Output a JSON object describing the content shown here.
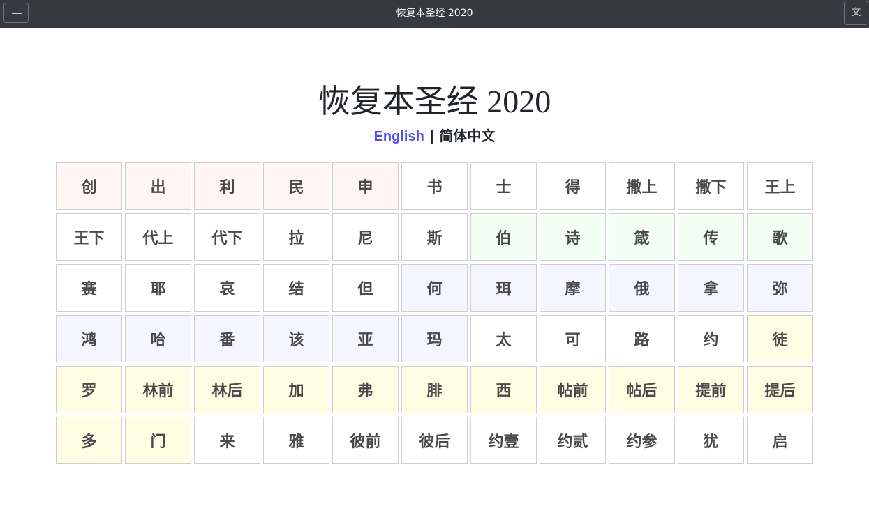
{
  "header": {
    "title": "恢复本圣经 2020",
    "menu_icon": "hamburger-menu-icon",
    "lang_button_label": "文"
  },
  "main": {
    "title": "恢复本圣经 2020",
    "languages": {
      "english": "English",
      "separator": "|",
      "chinese": "简体中文"
    }
  },
  "colors": {
    "law": "#fff5f5",
    "history": "#ffffff",
    "poetry": "#f3fff3",
    "prophets": "#f4f5ff",
    "new_testament": "#fefee4",
    "english_link": "#5050e6",
    "topbar": "#343a40"
  },
  "books": [
    {
      "name": "创",
      "group": "law"
    },
    {
      "name": "出",
      "group": "law"
    },
    {
      "name": "利",
      "group": "law"
    },
    {
      "name": "民",
      "group": "law"
    },
    {
      "name": "申",
      "group": "law"
    },
    {
      "name": "书",
      "group": "history"
    },
    {
      "name": "士",
      "group": "history"
    },
    {
      "name": "得",
      "group": "history"
    },
    {
      "name": "撒上",
      "group": "history"
    },
    {
      "name": "撒下",
      "group": "history"
    },
    {
      "name": "王上",
      "group": "history"
    },
    {
      "name": "王下",
      "group": "history"
    },
    {
      "name": "代上",
      "group": "history"
    },
    {
      "name": "代下",
      "group": "history"
    },
    {
      "name": "拉",
      "group": "history"
    },
    {
      "name": "尼",
      "group": "history"
    },
    {
      "name": "斯",
      "group": "history"
    },
    {
      "name": "伯",
      "group": "poetry"
    },
    {
      "name": "诗",
      "group": "poetry"
    },
    {
      "name": "箴",
      "group": "poetry"
    },
    {
      "name": "传",
      "group": "poetry"
    },
    {
      "name": "歌",
      "group": "poetry"
    },
    {
      "name": "赛",
      "group": "history"
    },
    {
      "name": "耶",
      "group": "history"
    },
    {
      "name": "哀",
      "group": "history"
    },
    {
      "name": "结",
      "group": "history"
    },
    {
      "name": "但",
      "group": "history"
    },
    {
      "name": "何",
      "group": "prophets"
    },
    {
      "name": "珥",
      "group": "prophets"
    },
    {
      "name": "摩",
      "group": "prophets"
    },
    {
      "name": "俄",
      "group": "prophets"
    },
    {
      "name": "拿",
      "group": "prophets"
    },
    {
      "name": "弥",
      "group": "prophets"
    },
    {
      "name": "鸿",
      "group": "prophets"
    },
    {
      "name": "哈",
      "group": "prophets"
    },
    {
      "name": "番",
      "group": "prophets"
    },
    {
      "name": "该",
      "group": "prophets"
    },
    {
      "name": "亚",
      "group": "prophets"
    },
    {
      "name": "玛",
      "group": "prophets"
    },
    {
      "name": "太",
      "group": "history"
    },
    {
      "name": "可",
      "group": "history"
    },
    {
      "name": "路",
      "group": "history"
    },
    {
      "name": "约",
      "group": "history"
    },
    {
      "name": "徒",
      "group": "new_testament"
    },
    {
      "name": "罗",
      "group": "new_testament"
    },
    {
      "name": "林前",
      "group": "new_testament"
    },
    {
      "name": "林后",
      "group": "new_testament"
    },
    {
      "name": "加",
      "group": "new_testament"
    },
    {
      "name": "弗",
      "group": "new_testament"
    },
    {
      "name": "腓",
      "group": "new_testament"
    },
    {
      "name": "西",
      "group": "new_testament"
    },
    {
      "name": "帖前",
      "group": "new_testament"
    },
    {
      "name": "帖后",
      "group": "new_testament"
    },
    {
      "name": "提前",
      "group": "new_testament"
    },
    {
      "name": "提后",
      "group": "new_testament"
    },
    {
      "name": "多",
      "group": "new_testament"
    },
    {
      "name": "门",
      "group": "new_testament"
    },
    {
      "name": "来",
      "group": "history"
    },
    {
      "name": "雅",
      "group": "history"
    },
    {
      "name": "彼前",
      "group": "history"
    },
    {
      "name": "彼后",
      "group": "history"
    },
    {
      "name": "约壹",
      "group": "history"
    },
    {
      "name": "约贰",
      "group": "history"
    },
    {
      "name": "约参",
      "group": "history"
    },
    {
      "name": "犹",
      "group": "history"
    },
    {
      "name": "启",
      "group": "history"
    }
  ]
}
